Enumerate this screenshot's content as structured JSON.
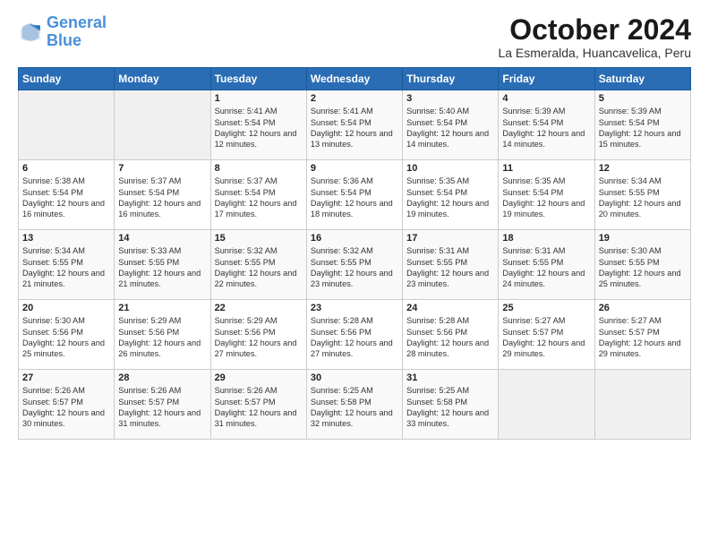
{
  "logo": {
    "line1": "General",
    "line2": "Blue"
  },
  "title": "October 2024",
  "subtitle": "La Esmeralda, Huancavelica, Peru",
  "weekdays": [
    "Sunday",
    "Monday",
    "Tuesday",
    "Wednesday",
    "Thursday",
    "Friday",
    "Saturday"
  ],
  "weeks": [
    [
      {
        "day": "",
        "info": ""
      },
      {
        "day": "",
        "info": ""
      },
      {
        "day": "1",
        "info": "Sunrise: 5:41 AM\nSunset: 5:54 PM\nDaylight: 12 hours\nand 12 minutes."
      },
      {
        "day": "2",
        "info": "Sunrise: 5:41 AM\nSunset: 5:54 PM\nDaylight: 12 hours\nand 13 minutes."
      },
      {
        "day": "3",
        "info": "Sunrise: 5:40 AM\nSunset: 5:54 PM\nDaylight: 12 hours\nand 14 minutes."
      },
      {
        "day": "4",
        "info": "Sunrise: 5:39 AM\nSunset: 5:54 PM\nDaylight: 12 hours\nand 14 minutes."
      },
      {
        "day": "5",
        "info": "Sunrise: 5:39 AM\nSunset: 5:54 PM\nDaylight: 12 hours\nand 15 minutes."
      }
    ],
    [
      {
        "day": "6",
        "info": "Sunrise: 5:38 AM\nSunset: 5:54 PM\nDaylight: 12 hours\nand 16 minutes."
      },
      {
        "day": "7",
        "info": "Sunrise: 5:37 AM\nSunset: 5:54 PM\nDaylight: 12 hours\nand 16 minutes."
      },
      {
        "day": "8",
        "info": "Sunrise: 5:37 AM\nSunset: 5:54 PM\nDaylight: 12 hours\nand 17 minutes."
      },
      {
        "day": "9",
        "info": "Sunrise: 5:36 AM\nSunset: 5:54 PM\nDaylight: 12 hours\nand 18 minutes."
      },
      {
        "day": "10",
        "info": "Sunrise: 5:35 AM\nSunset: 5:54 PM\nDaylight: 12 hours\nand 19 minutes."
      },
      {
        "day": "11",
        "info": "Sunrise: 5:35 AM\nSunset: 5:54 PM\nDaylight: 12 hours\nand 19 minutes."
      },
      {
        "day": "12",
        "info": "Sunrise: 5:34 AM\nSunset: 5:55 PM\nDaylight: 12 hours\nand 20 minutes."
      }
    ],
    [
      {
        "day": "13",
        "info": "Sunrise: 5:34 AM\nSunset: 5:55 PM\nDaylight: 12 hours\nand 21 minutes."
      },
      {
        "day": "14",
        "info": "Sunrise: 5:33 AM\nSunset: 5:55 PM\nDaylight: 12 hours\nand 21 minutes."
      },
      {
        "day": "15",
        "info": "Sunrise: 5:32 AM\nSunset: 5:55 PM\nDaylight: 12 hours\nand 22 minutes."
      },
      {
        "day": "16",
        "info": "Sunrise: 5:32 AM\nSunset: 5:55 PM\nDaylight: 12 hours\nand 23 minutes."
      },
      {
        "day": "17",
        "info": "Sunrise: 5:31 AM\nSunset: 5:55 PM\nDaylight: 12 hours\nand 23 minutes."
      },
      {
        "day": "18",
        "info": "Sunrise: 5:31 AM\nSunset: 5:55 PM\nDaylight: 12 hours\nand 24 minutes."
      },
      {
        "day": "19",
        "info": "Sunrise: 5:30 AM\nSunset: 5:55 PM\nDaylight: 12 hours\nand 25 minutes."
      }
    ],
    [
      {
        "day": "20",
        "info": "Sunrise: 5:30 AM\nSunset: 5:56 PM\nDaylight: 12 hours\nand 25 minutes."
      },
      {
        "day": "21",
        "info": "Sunrise: 5:29 AM\nSunset: 5:56 PM\nDaylight: 12 hours\nand 26 minutes."
      },
      {
        "day": "22",
        "info": "Sunrise: 5:29 AM\nSunset: 5:56 PM\nDaylight: 12 hours\nand 27 minutes."
      },
      {
        "day": "23",
        "info": "Sunrise: 5:28 AM\nSunset: 5:56 PM\nDaylight: 12 hours\nand 27 minutes."
      },
      {
        "day": "24",
        "info": "Sunrise: 5:28 AM\nSunset: 5:56 PM\nDaylight: 12 hours\nand 28 minutes."
      },
      {
        "day": "25",
        "info": "Sunrise: 5:27 AM\nSunset: 5:57 PM\nDaylight: 12 hours\nand 29 minutes."
      },
      {
        "day": "26",
        "info": "Sunrise: 5:27 AM\nSunset: 5:57 PM\nDaylight: 12 hours\nand 29 minutes."
      }
    ],
    [
      {
        "day": "27",
        "info": "Sunrise: 5:26 AM\nSunset: 5:57 PM\nDaylight: 12 hours\nand 30 minutes."
      },
      {
        "day": "28",
        "info": "Sunrise: 5:26 AM\nSunset: 5:57 PM\nDaylight: 12 hours\nand 31 minutes."
      },
      {
        "day": "29",
        "info": "Sunrise: 5:26 AM\nSunset: 5:57 PM\nDaylight: 12 hours\nand 31 minutes."
      },
      {
        "day": "30",
        "info": "Sunrise: 5:25 AM\nSunset: 5:58 PM\nDaylight: 12 hours\nand 32 minutes."
      },
      {
        "day": "31",
        "info": "Sunrise: 5:25 AM\nSunset: 5:58 PM\nDaylight: 12 hours\nand 33 minutes."
      },
      {
        "day": "",
        "info": ""
      },
      {
        "day": "",
        "info": ""
      }
    ]
  ]
}
